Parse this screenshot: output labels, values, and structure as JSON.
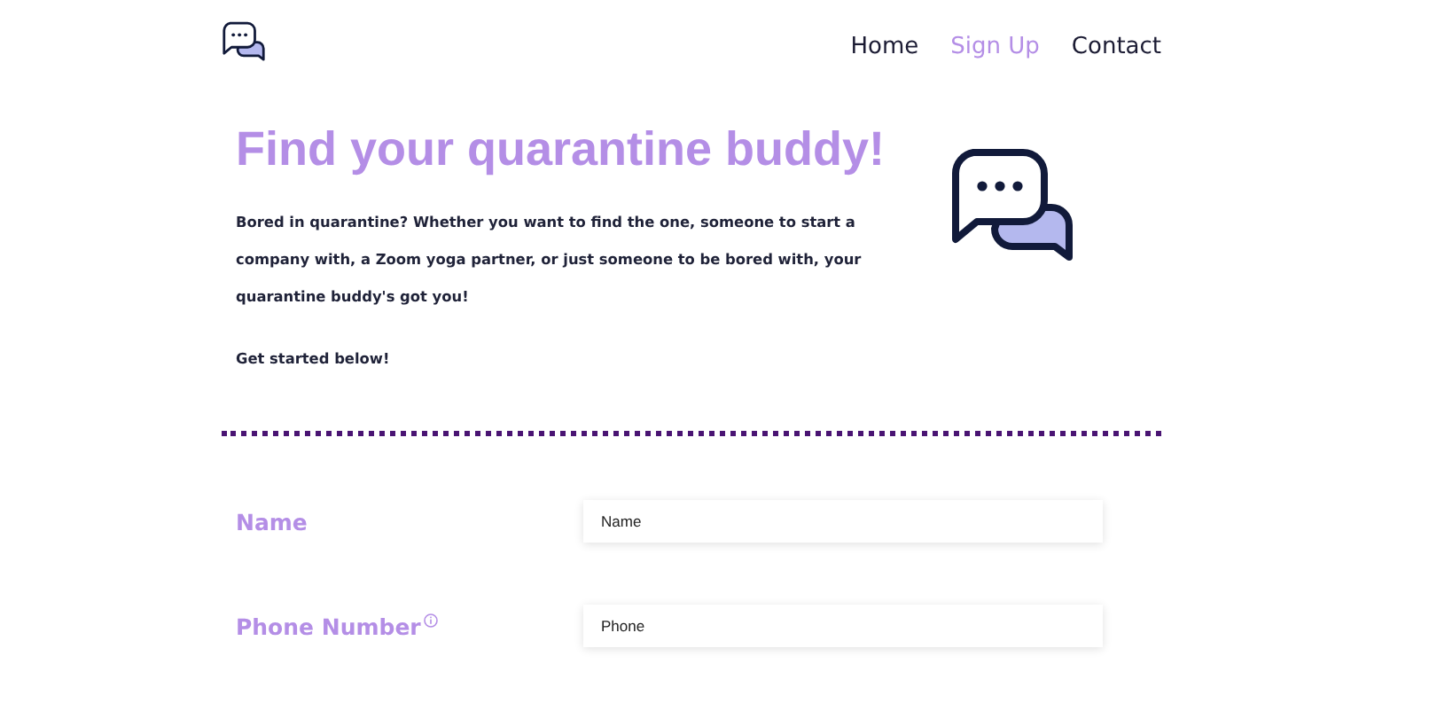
{
  "nav": [
    {
      "label": "Home",
      "selected": false
    },
    {
      "label": "Sign Up",
      "selected": true
    },
    {
      "label": "Contact",
      "selected": false
    }
  ],
  "hero": {
    "title": "Find your quarantine buddy!",
    "paragraphs": [
      "Bored in quarantine? Whether you want to find the one, someone to start a company with, a Zoom yoga partner, or just someone to be bored with, your quarantine buddy's got you!",
      "Get started below!"
    ]
  },
  "form": {
    "fields": [
      {
        "label": "Name",
        "placeholder": "Name",
        "info": false
      },
      {
        "label": "Phone Number",
        "placeholder": "Phone",
        "info": true
      }
    ]
  }
}
